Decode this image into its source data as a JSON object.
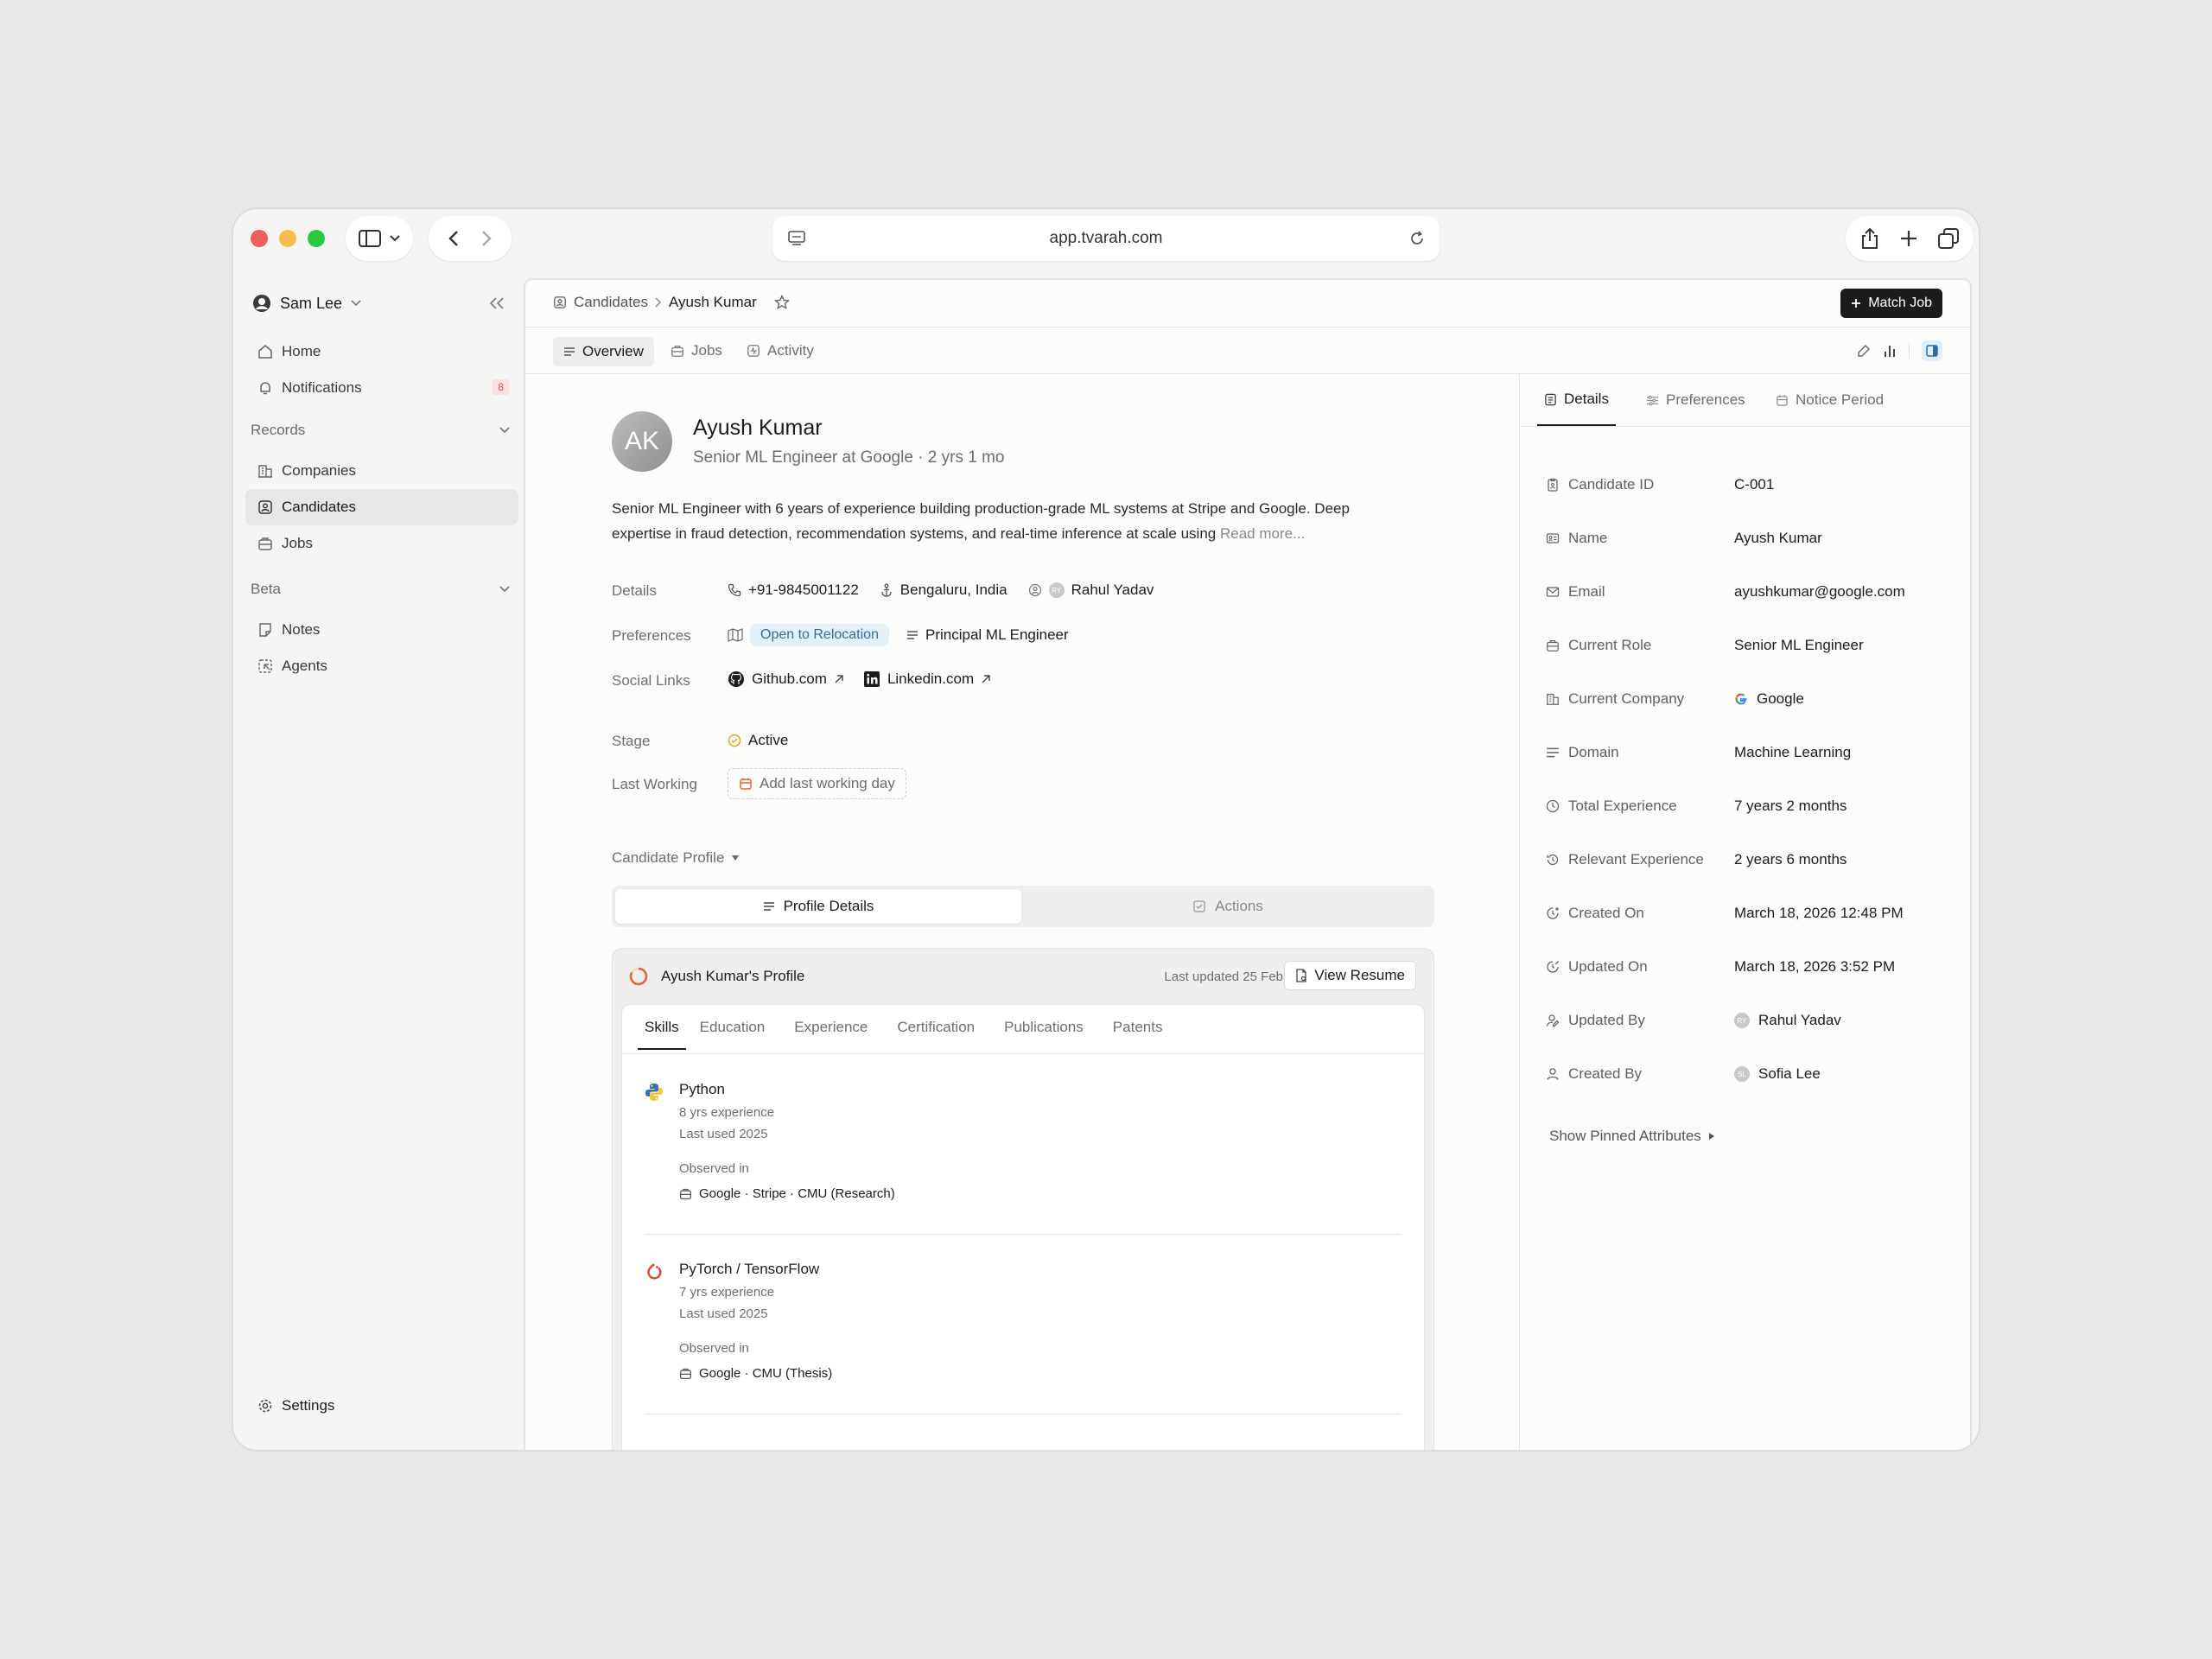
{
  "browser": {
    "url": "app.tvarah.com"
  },
  "sidebar": {
    "user_name": "Sam Lee",
    "nav": [
      {
        "label": "Home",
        "icon": "home-icon"
      },
      {
        "label": "Notifications",
        "icon": "bell-icon",
        "badge": "8"
      }
    ],
    "records_label": "Records",
    "records": [
      {
        "label": "Companies",
        "icon": "building-icon"
      },
      {
        "label": "Candidates",
        "icon": "candidate-icon",
        "active": true
      },
      {
        "label": "Jobs",
        "icon": "briefcase-icon"
      }
    ],
    "beta_label": "Beta",
    "beta": [
      {
        "label": "Notes",
        "icon": "note-icon"
      },
      {
        "label": "Agents",
        "icon": "agent-icon"
      }
    ],
    "settings_label": "Settings"
  },
  "header": {
    "breadcrumb_root": "Candidates",
    "breadcrumb_current": "Ayush Kumar",
    "match_job_label": "Match Job",
    "tabs": [
      "Overview",
      "Jobs",
      "Activity"
    ]
  },
  "candidate": {
    "initials": "AK",
    "name": "Ayush Kumar",
    "headline": "Senior ML Engineer at Google · 2 yrs 1 mo",
    "bio_line1": "Senior ML Engineer with 6 years of experience building production-grade ML systems at Stripe and Google. Deep",
    "bio_line2": "expertise in fraud detection, recommendation systems, and real-time inference at scale using",
    "read_more": "Read more...",
    "details_label": "Details",
    "phone": "+91-9845001122",
    "location": "Bengaluru, India",
    "owner": "Rahul Yadav",
    "preferences_label": "Preferences",
    "relocation": "Open to Relocation",
    "preferred_role": "Principal ML Engineer",
    "social_label": "Social Links",
    "github": "Github.com",
    "linkedin": "Linkedin.com",
    "stage_label": "Stage",
    "stage": "Active",
    "last_working_label": "Last Working",
    "last_working_placeholder": "Add last working day",
    "profile_toggle": "Candidate Profile",
    "segment_profile": "Profile Details",
    "segment_actions": "Actions"
  },
  "profile_card": {
    "title": "Ayush Kumar's Profile",
    "last_updated": "Last updated 25 Feb",
    "view_resume": "View Resume",
    "tabs": [
      "Skills",
      "Education",
      "Experience",
      "Certification",
      "Publications",
      "Patents"
    ],
    "observed_label": "Observed in",
    "skills": [
      {
        "name": "Python",
        "experience": "8 yrs experience",
        "last_used": "Last used 2025",
        "observed": "Google · Stripe · CMU (Research)",
        "icon": "python-icon"
      },
      {
        "name": "PyTorch / TensorFlow",
        "experience": "7 yrs experience",
        "last_used": "Last used 2025",
        "observed": "Google · CMU (Thesis)",
        "icon": "pytorch-icon"
      }
    ]
  },
  "details_panel": {
    "tabs": [
      "Details",
      "Preferences",
      "Notice Period"
    ],
    "rows": [
      {
        "label": "Candidate ID",
        "value": "C-001",
        "icon": "id-icon"
      },
      {
        "label": "Name",
        "value": "Ayush Kumar",
        "icon": "name-card-icon"
      },
      {
        "label": "Email",
        "value": "ayushkumar@google.com",
        "icon": "mail-icon"
      },
      {
        "label": "Current Role",
        "value": "Senior ML Engineer",
        "icon": "briefcase-icon"
      },
      {
        "label": "Current Company",
        "value": "Google",
        "icon": "building-icon"
      },
      {
        "label": "Domain",
        "value": "Machine Learning",
        "icon": "lines-icon"
      },
      {
        "label": "Total Experience",
        "value": "7 years 2 months",
        "icon": "clock-icon"
      },
      {
        "label": "Relevant Experience",
        "value": "2 years 6 months",
        "icon": "history-icon"
      },
      {
        "label": "Created On",
        "value": "March 18, 2026 12:48 PM",
        "icon": "clock-plus-icon"
      },
      {
        "label": "Updated On",
        "value": "March 18, 2026 3:52 PM",
        "icon": "clock-edit-icon"
      },
      {
        "label": "Updated By",
        "value": "Rahul Yadav",
        "icon": "user-edit-icon"
      },
      {
        "label": "Created By",
        "value": "Sofia Lee",
        "icon": "user-icon"
      }
    ],
    "show_pinned": "Show Pinned Attributes"
  },
  "colors": {
    "close": "#ee5f57",
    "minimize": "#f5bd4f",
    "zoom": "#2ac840",
    "badge_red": "#d9534f",
    "accent_blue": "#2c6ea3",
    "active_amber": "#e8a21c"
  }
}
